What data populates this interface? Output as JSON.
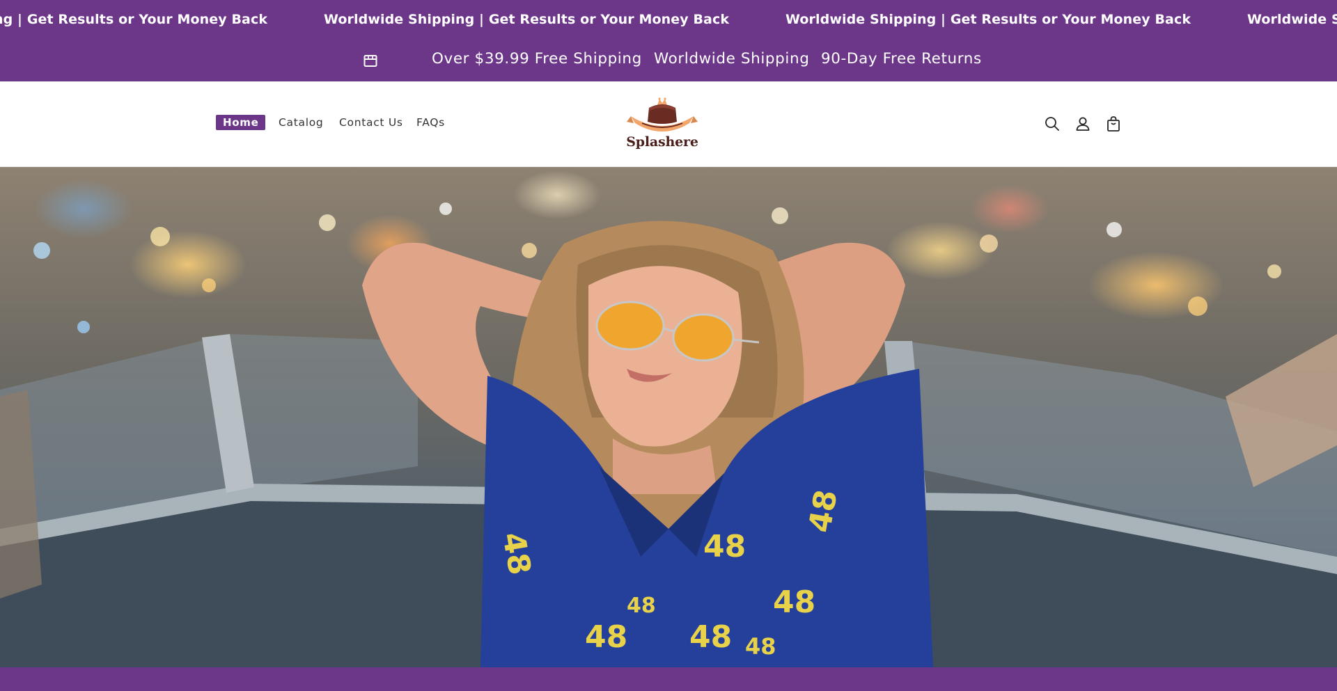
{
  "marquee": {
    "items": [
      "Worldwide Shipping | Get Results or Your Money Back",
      "Worldwide Shipping | Get Results or Your Money Back",
      "Worldwide Shipping | Get Results or Your Money Back",
      "Worldwide Shipping | Get Results or Your Money Back"
    ]
  },
  "announcement": {
    "icon": "store-icon",
    "free_shipping": "Over $39.99 Free Shipping",
    "worldwide": "Worldwide Shipping",
    "returns": "90-Day Free Returns"
  },
  "nav": {
    "home": "Home",
    "catalog": "Catalog",
    "contact": "Contact Us",
    "faqs": "FAQs"
  },
  "brand": {
    "name": "Splashere"
  },
  "header_icons": [
    "search-icon",
    "account-icon",
    "cart-icon"
  ],
  "colors": {
    "brand_purple": "#6d3789",
    "logo_brown": "#4a1f1b",
    "logo_orange": "#f3a66b"
  }
}
